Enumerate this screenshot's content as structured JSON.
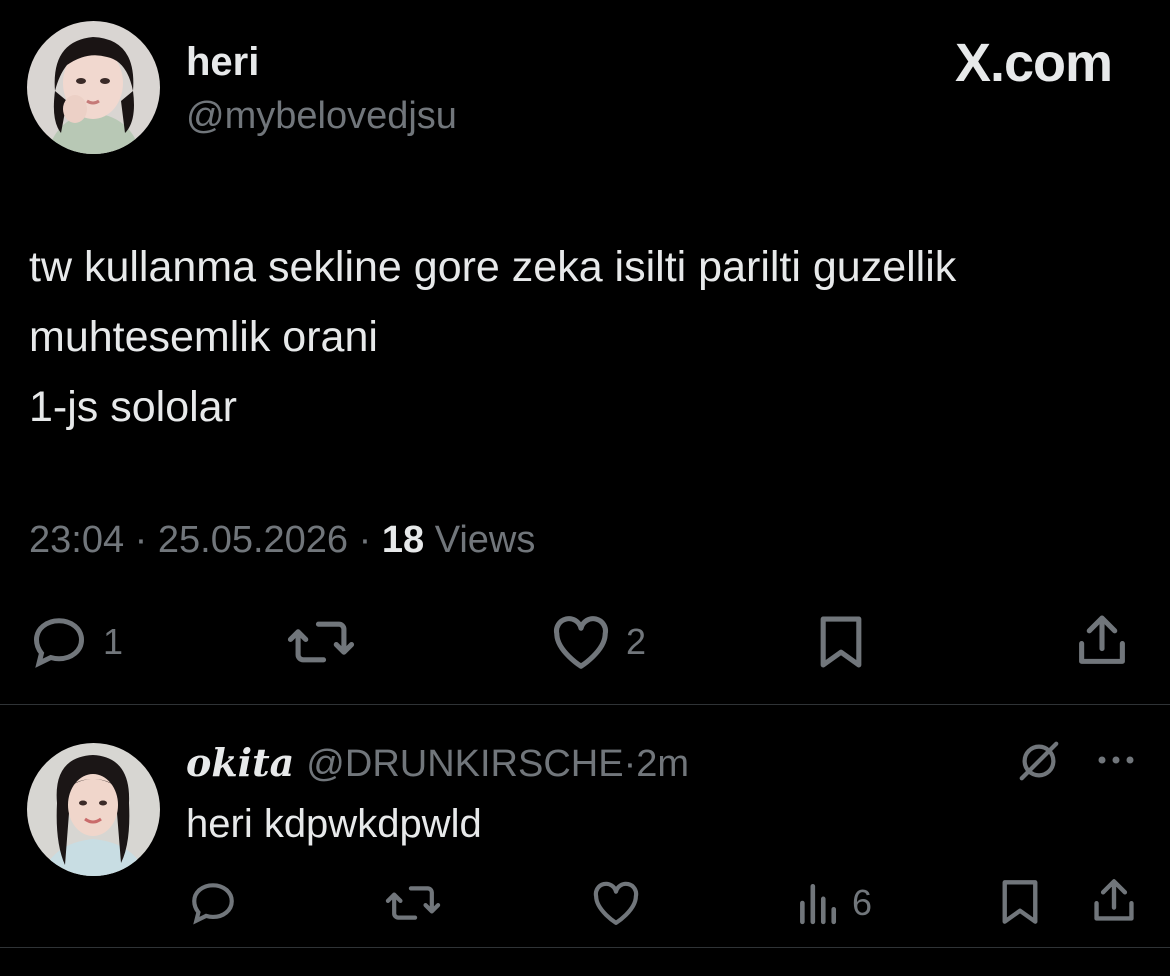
{
  "main_tweet": {
    "author": {
      "display_name": "heri",
      "handle": "@mybelovedjsu"
    },
    "source_watermark": "X.com",
    "text_lines": [
      "tw kullanma sekline gore zeka isilti parilti guzellik",
      "muhtesemlik orani",
      "1-js sololar"
    ],
    "time": "23:04",
    "separator": "·",
    "date": "25.05.2026",
    "views_count": "18",
    "views_label": "Views",
    "actions": {
      "reply_count": "1",
      "like_count": "2"
    }
  },
  "reply": {
    "display_name": "okita",
    "handle": "@DRUNKIRSCHE",
    "separator": "·",
    "time_ago": "2m",
    "text": "heri kdpwkdpwld",
    "actions": {
      "views_count": "6"
    }
  },
  "colors": {
    "background": "#000000",
    "primary_text": "#e7e9ea",
    "secondary_text": "#71767b",
    "divider": "#2f3336"
  }
}
